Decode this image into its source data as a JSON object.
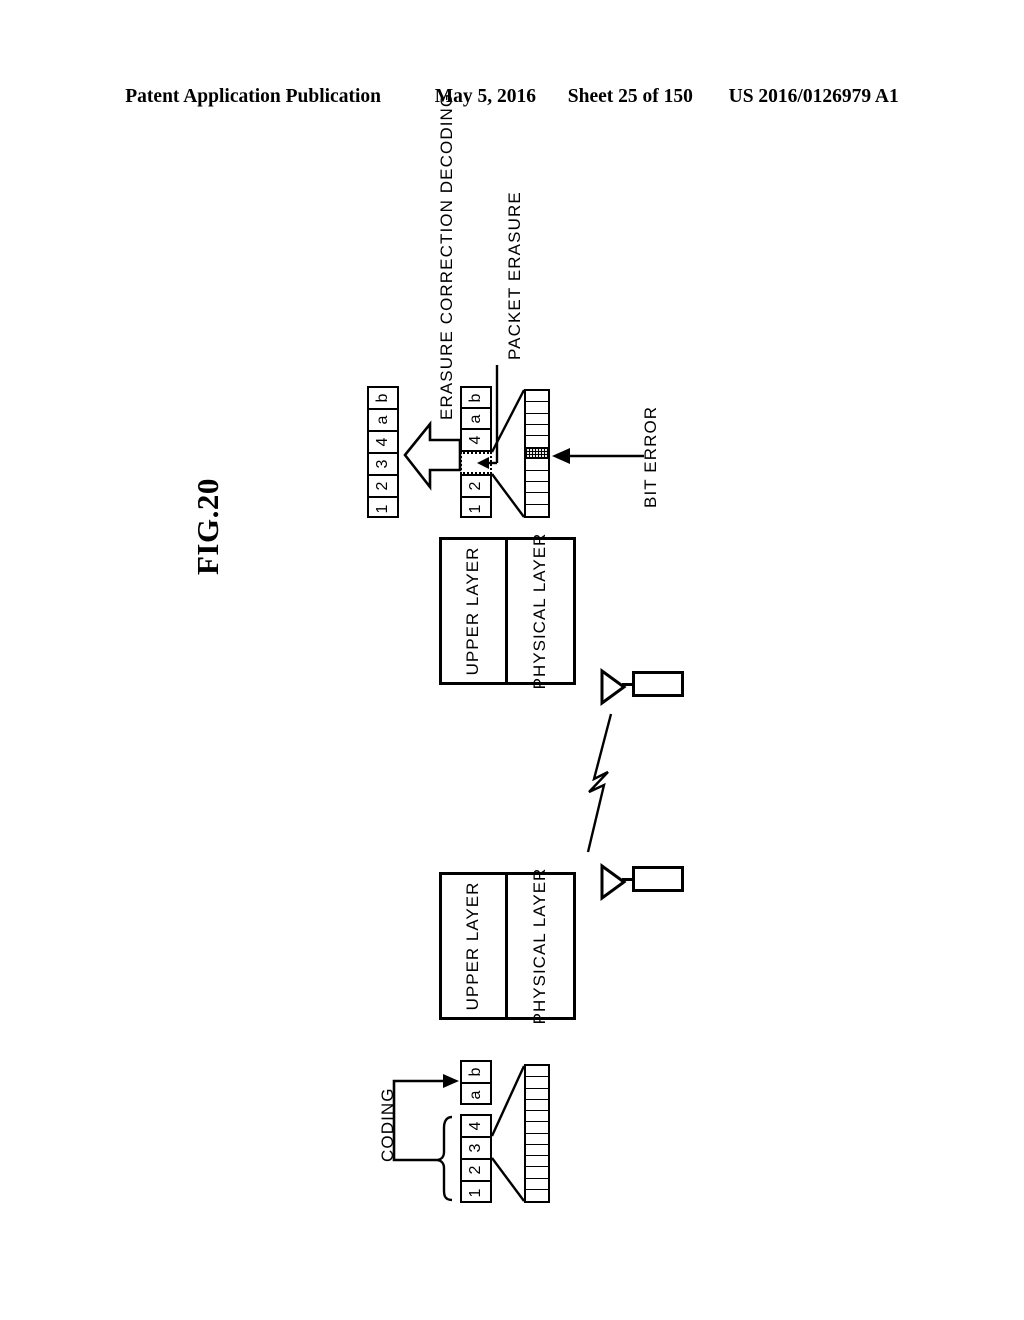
{
  "header": {
    "publication": "Patent Application Publication",
    "date": "May 5, 2016",
    "sheet": "Sheet 25 of 150",
    "docnum": "US 2016/0126979 A1"
  },
  "figure": {
    "label": "FIG.20",
    "ink_color": "#000000",
    "paper_color": "#ffffff"
  },
  "captions": {
    "erasure_correction_decoding": "ERASURE CORRECTION DECODING",
    "packet_erasure": "PACKET ERASURE",
    "bit_error": "BIT ERROR",
    "coding": "CODING"
  },
  "receiver": {
    "decoded_packets": {
      "name": "decoded-packet-sequence",
      "cells": [
        "1",
        "2",
        "3",
        "4",
        "a",
        "b"
      ]
    },
    "received_packets": {
      "name": "received-packet-sequence",
      "cells": [
        "1",
        "2",
        "",
        "4",
        "a",
        "b"
      ],
      "erased_index": 2,
      "erased_label": ""
    },
    "bitstream": {
      "name": "receiver-bitstream",
      "bit_count": 11,
      "error_bit_index": 5
    },
    "stack": {
      "upper_layer": "UPPER LAYER",
      "physical_layer": "PHYSICAL LAYER"
    },
    "antenna": "receiver-antenna"
  },
  "transmitter": {
    "parity_packets": {
      "name": "parity-packet-sequence",
      "cells": [
        "a",
        "b"
      ]
    },
    "information_packets": {
      "name": "information-packet-sequence",
      "cells": [
        "1",
        "2",
        "3",
        "4"
      ]
    },
    "bitstream": {
      "name": "transmitter-bitstream",
      "bit_count": 12
    },
    "stack": {
      "upper_layer": "UPPER LAYER",
      "physical_layer": "PHYSICAL LAYER"
    },
    "antenna": "transmitter-antenna"
  },
  "channel": {
    "name": "wireless-channel",
    "symbol": "lightning-bolt"
  }
}
